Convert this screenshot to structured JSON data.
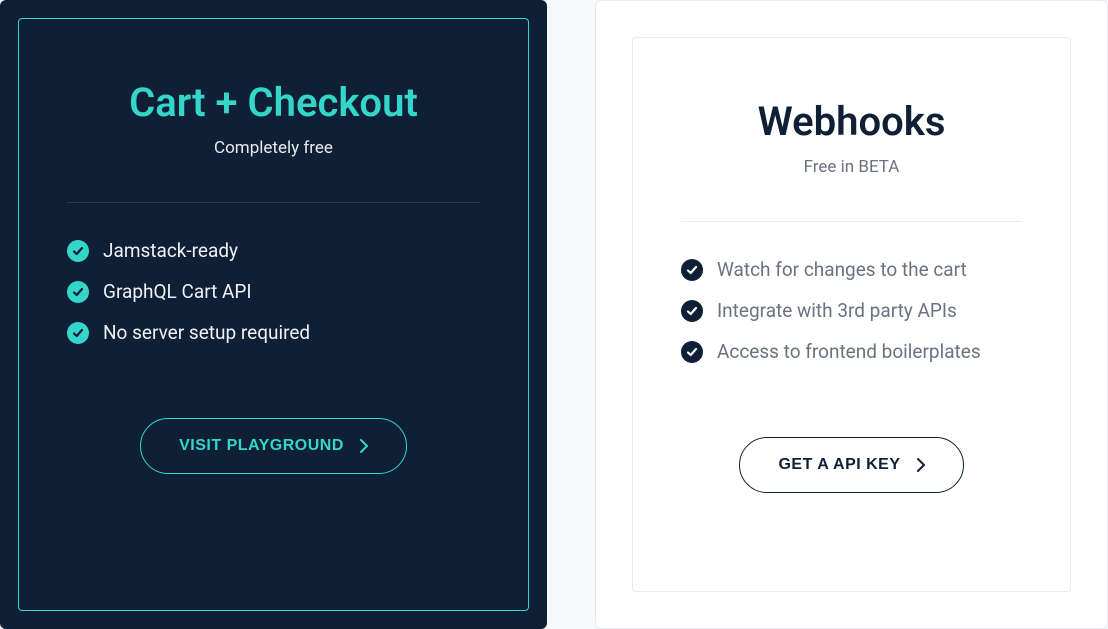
{
  "cards": [
    {
      "title": "Cart + Checkout",
      "subtitle": "Completely free",
      "features": [
        "Jamstack-ready",
        "GraphQL Cart API",
        "No server setup required"
      ],
      "cta_label": "VISIT PLAYGROUND"
    },
    {
      "title": "Webhooks",
      "subtitle": "Free in BETA",
      "features": [
        "Watch for changes to the cart",
        "Integrate with 3rd party APIs",
        "Access to frontend boilerplates"
      ],
      "cta_label": "GET A API KEY"
    }
  ]
}
